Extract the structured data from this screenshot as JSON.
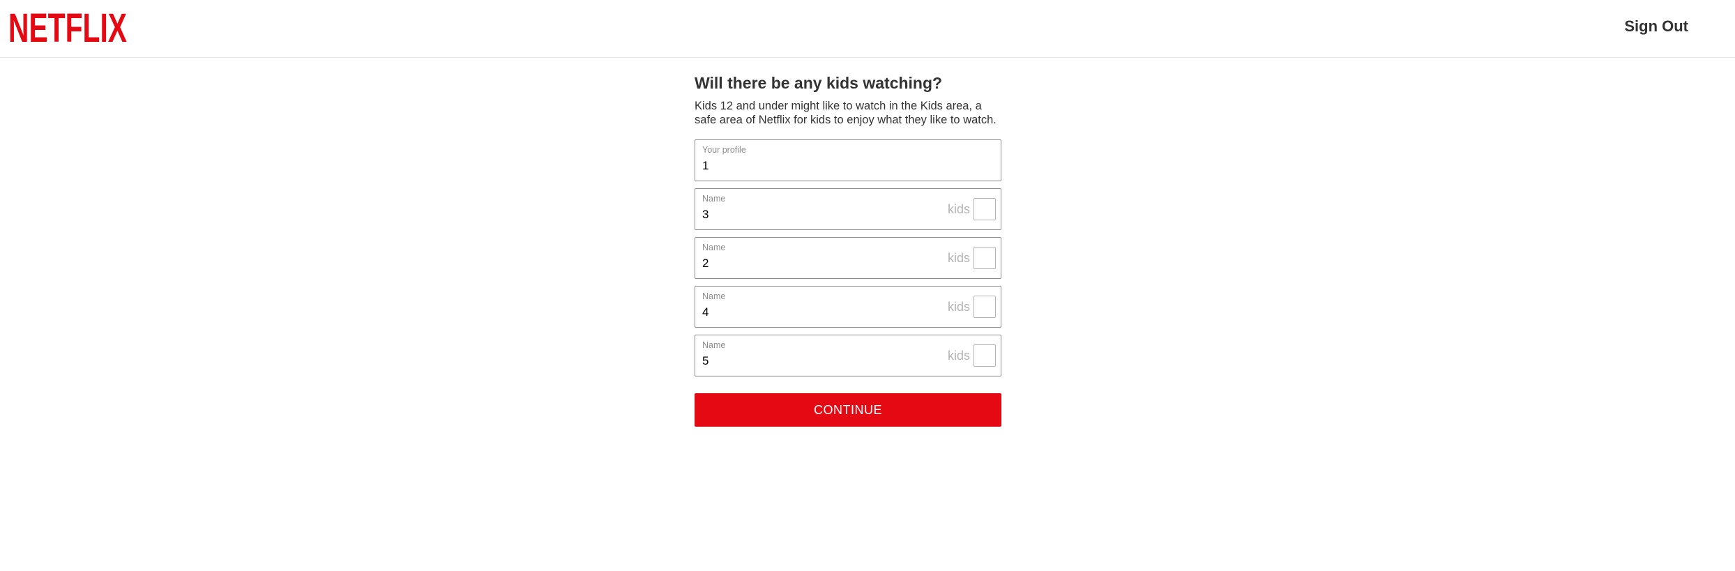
{
  "header": {
    "logo_text": "NETFLIX",
    "brand_color": "#e50914",
    "sign_out_label": "Sign Out"
  },
  "main": {
    "title": "Will there be any kids watching?",
    "description": "Kids 12 and under might like to watch in the Kids area, a safe area of Netflix for kids to enjoy what they like to watch.",
    "your_profile": {
      "label": "Your profile",
      "value": "1"
    },
    "profiles": [
      {
        "label": "Name",
        "value": "3",
        "kids_label": "kids",
        "kids_checked": false
      },
      {
        "label": "Name",
        "value": "2",
        "kids_label": "kids",
        "kids_checked": false
      },
      {
        "label": "Name",
        "value": "4",
        "kids_label": "kids",
        "kids_checked": false
      },
      {
        "label": "Name",
        "value": "5",
        "kids_label": "kids",
        "kids_checked": false
      }
    ],
    "continue_label": "CONTINUE"
  }
}
